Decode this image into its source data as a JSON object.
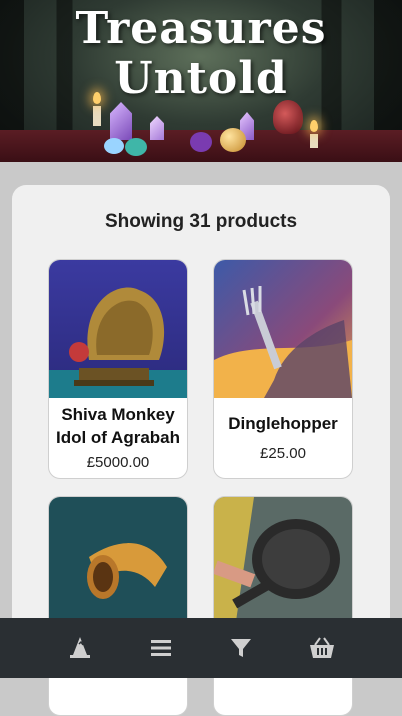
{
  "header": {
    "title_line1": "Treasures",
    "title_line2": "Untold"
  },
  "results": {
    "count_text": "Showing 31 products"
  },
  "products": [
    {
      "name": "Shiva Monkey Idol of Agrabah",
      "price": "£5000.00"
    },
    {
      "name": "Dinglehopper",
      "price": "£25.00"
    },
    {
      "name": "",
      "price": ""
    },
    {
      "name": "",
      "price": ""
    }
  ],
  "nav": {
    "icons": [
      "wizard-hat-icon",
      "menu-icon",
      "filter-icon",
      "basket-icon"
    ]
  },
  "colors": {
    "navbar": "#2a2f33",
    "card": "#f0f0f0",
    "page_bg": "#c9c9c9"
  }
}
